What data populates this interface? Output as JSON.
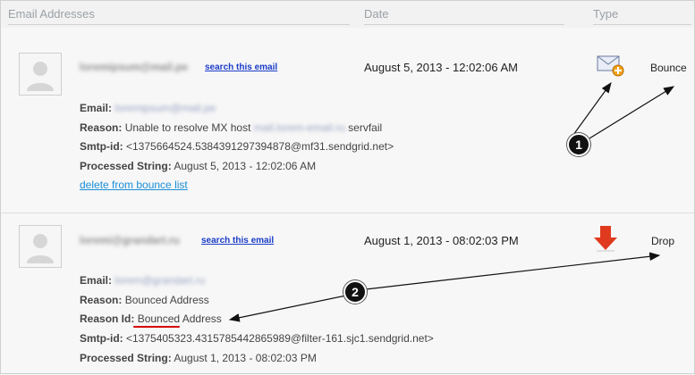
{
  "header": {
    "col_email": "Email Addresses",
    "col_date": "Date",
    "col_type": "Type"
  },
  "rows": [
    {
      "email_blurred": "loremipsum@mail.pe",
      "search_label": "search this email",
      "date": "August 5, 2013 - 12:02:06 AM",
      "type": "Bounce",
      "type_icon": "envelope-warning-icon",
      "fields": {
        "email_label": "Email:",
        "email_value": "loremipsum@mail.pe",
        "reason_label": "Reason:",
        "reason_prefix": "Unable to resolve MX host",
        "reason_blurred": "mail.lorem-email.ru",
        "reason_suffix": "servfail",
        "smtp_label": "Smtp-id:",
        "smtp_value": "<1375664524.5384391297394878@mf31.sendgrid.net>",
        "processed_label": "Processed String:",
        "processed_value": "August 5, 2013 - 12:02:06 AM"
      },
      "delete_label": "delete from bounce list"
    },
    {
      "email_blurred": "loremi@grandart.ru",
      "search_label": "search this email",
      "date": "August 1, 2013 - 08:02:03 PM",
      "type": "Drop",
      "type_icon": "down-arrow-icon",
      "fields": {
        "email_label": "Email:",
        "email_value": "lorem@grandart.ru",
        "reason_label": "Reason:",
        "reason_value": "Bounced Address",
        "reasonid_label": "Reason Id:",
        "reasonid_value": "Bounced Address",
        "smtp_label": "Smtp-id:",
        "smtp_value": "<1375405323.4315785442865989@filter-161.sjc1.sendgrid.net>",
        "processed_label": "Processed String:",
        "processed_value": "August 1, 2013 - 08:02:03 PM"
      }
    }
  ],
  "annotations": {
    "badge_1": "1",
    "badge_2": "2"
  },
  "colors": {
    "link": "#1a3cc8",
    "delete_link": "#1a8ed8",
    "drop_arrow": "#e03a1e",
    "annotation_underline": "#d40000"
  }
}
